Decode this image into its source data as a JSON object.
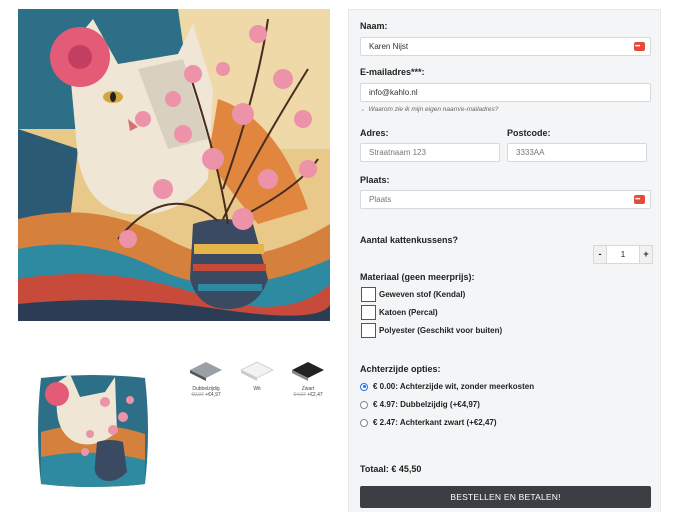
{
  "form": {
    "name_label": "Naam:",
    "name_value": "Karen Nijst",
    "email_label": "E-mailadres***:",
    "email_value": "info@kahlo.nl",
    "email_hint": "Waarom zie ik mijn eigen naam/e-mailadres?",
    "address_label": "Adres:",
    "address_placeholder": "Straatnaam 123",
    "postcode_label": "Postcode:",
    "postcode_placeholder": "3333AA",
    "city_label": "Plaats:",
    "city_placeholder": "Plaats",
    "quantity_label": "Aantal kattenkussens?",
    "quantity_minus": "-",
    "quantity_value": "1",
    "quantity_plus": "+",
    "material_label": "Materiaal (geen meerprijs):",
    "materials": [
      "Geweven stof (Kendal)",
      "Katoen (Percal)",
      "Polyester (Geschikt voor buiten)"
    ],
    "back_label": "Achterzijde opties:",
    "back_options": [
      "€ 0.00: Achterzijde wit, zonder meerkosten",
      "€ 4.97: Dubbelzijdig (+€4,97)",
      "€ 2.47: Achterkant zwart (+€2,47)"
    ],
    "back_selected": 0,
    "total": "Totaal: € 45,50",
    "order_button": "BESTELLEN EN BETALEN!"
  },
  "variants": [
    {
      "label": "Dubbelzijdig",
      "old_price": "€9,97",
      "price": "+€4,97"
    },
    {
      "label": "Wit",
      "old_price": "",
      "price": ""
    },
    {
      "label": "Zwart",
      "old_price": "€4,97",
      "price": "+€2,47"
    }
  ],
  "colors": {
    "accent_red": "#e64a3b",
    "button_dark": "#3b3f44",
    "radio_blue": "#1a73e8"
  }
}
